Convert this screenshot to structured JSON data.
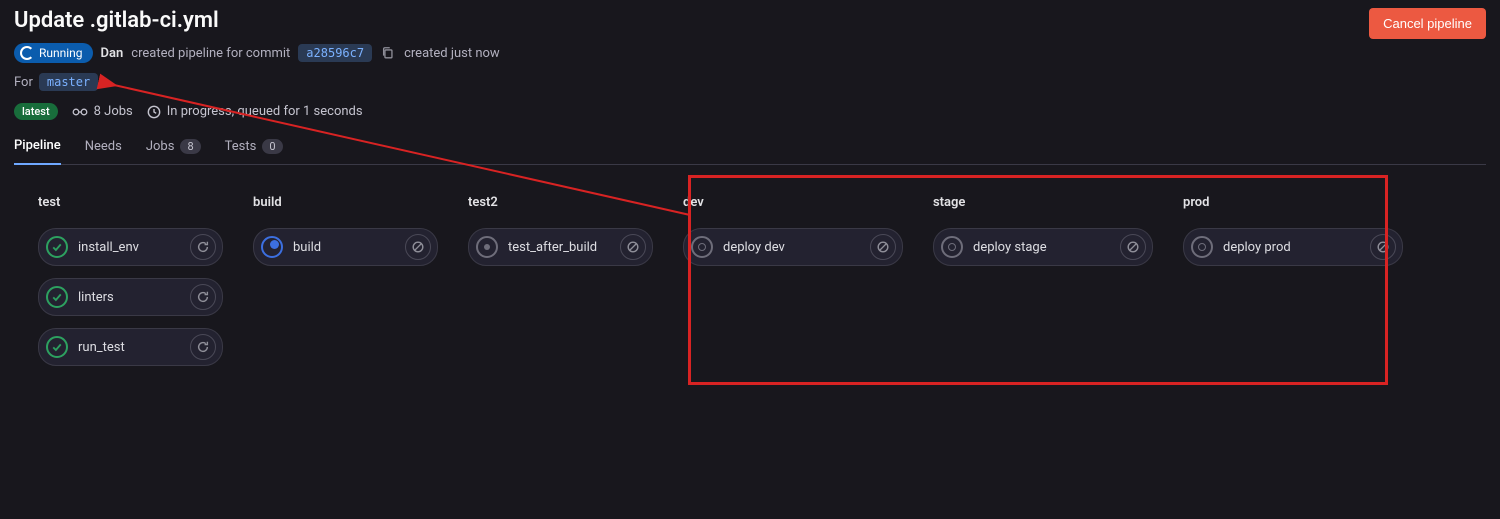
{
  "header": {
    "title": "Update .gitlab-ci.yml",
    "cancel_label": "Cancel pipeline",
    "status_label": "Running",
    "author": "Dan",
    "action_text": "created pipeline for commit",
    "commit_sha": "a28596c7",
    "created_text": "created just now"
  },
  "branch": {
    "for_label": "For",
    "name": "master"
  },
  "summary": {
    "latest_label": "latest",
    "jobs_count": "8 Jobs",
    "progress_text": "In progress, queued for 1 seconds"
  },
  "tabs": [
    {
      "label": "Pipeline",
      "count": null,
      "active": true
    },
    {
      "label": "Needs",
      "count": null,
      "active": false
    },
    {
      "label": "Jobs",
      "count": "8",
      "active": false
    },
    {
      "label": "Tests",
      "count": "0",
      "active": false
    }
  ],
  "stages": [
    {
      "name": "test",
      "jobs": [
        {
          "name": "install_env",
          "status": "success",
          "action": "retry"
        },
        {
          "name": "linters",
          "status": "success",
          "action": "retry"
        },
        {
          "name": "run_test",
          "status": "success",
          "action": "retry"
        }
      ]
    },
    {
      "name": "build",
      "jobs": [
        {
          "name": "build",
          "status": "running",
          "action": "cancel"
        }
      ]
    },
    {
      "name": "test2",
      "jobs": [
        {
          "name": "test_after_build",
          "status": "created",
          "action": "cancel"
        }
      ]
    },
    {
      "name": "dev",
      "jobs": [
        {
          "name": "deploy dev",
          "status": "manual",
          "action": "cancel"
        }
      ]
    },
    {
      "name": "stage",
      "jobs": [
        {
          "name": "deploy stage",
          "status": "manual",
          "action": "cancel"
        }
      ]
    },
    {
      "name": "prod",
      "jobs": [
        {
          "name": "deploy prod",
          "status": "manual",
          "action": "cancel"
        }
      ]
    }
  ]
}
